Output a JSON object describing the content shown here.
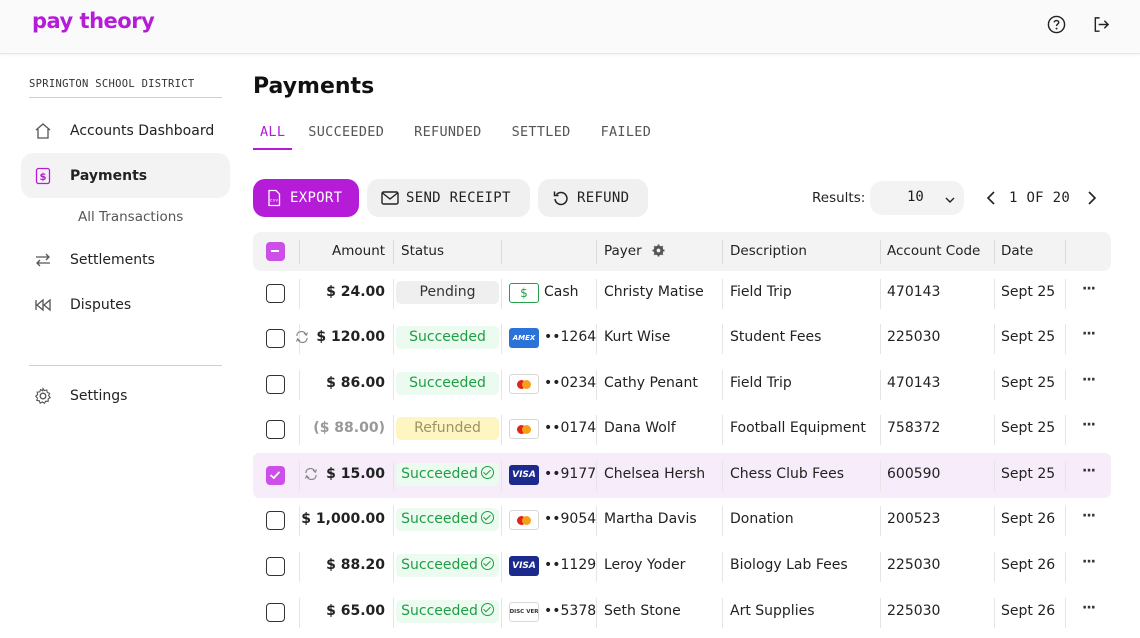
{
  "brand": {
    "logo": "pay theory",
    "accent": "#b51cd8"
  },
  "header": {
    "icons": [
      "help-icon",
      "logout-icon"
    ]
  },
  "sidebar": {
    "district": "SPRINGTON SCHOOL DISTRICT",
    "items": [
      {
        "label": "Accounts Dashboard",
        "icon": "home-icon"
      },
      {
        "label": "Payments",
        "icon": "dollar-doc-icon",
        "active": true
      },
      {
        "label": "Settlements",
        "icon": "swap-arrows-icon"
      },
      {
        "label": "Disputes",
        "icon": "rewind-icon"
      },
      {
        "label": "Settings",
        "icon": "gear-icon"
      }
    ],
    "sub_item": "All Transactions"
  },
  "main": {
    "title": "Payments",
    "tabs": [
      {
        "label": "ALL",
        "active": true
      },
      {
        "label": "SUCCEEDED"
      },
      {
        "label": "REFUNDED"
      },
      {
        "label": "SETTLED"
      },
      {
        "label": "FAILED"
      }
    ],
    "actions": {
      "export": "EXPORT",
      "send_receipt": "SEND RECEIPT",
      "refund": "REFUND"
    },
    "results": {
      "label": "Results:",
      "value": "10"
    },
    "pager": {
      "text": "1 OF 20",
      "current": 1,
      "total": 20
    }
  },
  "table": {
    "columns": [
      "Amount",
      "Status",
      "Payer",
      "Description",
      "Account Code",
      "Date"
    ],
    "rows": [
      {
        "amount": "$ 24.00",
        "recurring": false,
        "status": "Pending",
        "verified": false,
        "method": "cash",
        "method_text": "Cash",
        "payer": "Christy Matise",
        "description": "Field Trip",
        "account_code": "470143",
        "date": "Sept 25",
        "checked": false
      },
      {
        "amount": "$ 120.00",
        "recurring": true,
        "status": "Succeeded",
        "verified": false,
        "method": "amex",
        "method_text": "••1264",
        "payer": "Kurt Wise",
        "description": "Student Fees",
        "account_code": "225030",
        "date": "Sept 25",
        "checked": false
      },
      {
        "amount": "$ 86.00",
        "recurring": false,
        "status": "Succeeded",
        "verified": false,
        "method": "mastercard",
        "method_text": "••0234",
        "payer": "Cathy Penant",
        "description": "Field Trip",
        "account_code": "470143",
        "date": "Sept 25",
        "checked": false
      },
      {
        "amount": "($ 88.00)",
        "recurring": false,
        "status": "Refunded",
        "verified": false,
        "method": "mastercard",
        "method_text": "••0174",
        "payer": "Dana Wolf",
        "description": "Football Equipment",
        "account_code": "758372",
        "date": "Sept 25",
        "checked": false
      },
      {
        "amount": "$ 15.00",
        "recurring": true,
        "status": "Succeeded",
        "verified": true,
        "method": "visa",
        "method_text": "••9177",
        "payer": "Chelsea Hersh",
        "description": "Chess Club Fees",
        "account_code": "600590",
        "date": "Sept 25",
        "checked": true
      },
      {
        "amount": "$ 1,000.00",
        "recurring": false,
        "status": "Succeeded",
        "verified": true,
        "method": "mastercard",
        "method_text": "••9054",
        "payer": "Martha Davis",
        "description": "Donation",
        "account_code": "200523",
        "date": "Sept 26",
        "checked": false
      },
      {
        "amount": "$ 88.20",
        "recurring": false,
        "status": "Succeeded",
        "verified": true,
        "method": "visa",
        "method_text": "••1129",
        "payer": "Leroy Yoder",
        "description": "Biology Lab Fees",
        "account_code": "225030",
        "date": "Sept 26",
        "checked": false
      },
      {
        "amount": "$ 65.00",
        "recurring": false,
        "status": "Succeeded",
        "verified": true,
        "method": "discover",
        "method_text": "••5378",
        "payer": "Seth Stone",
        "description": "Art Supplies",
        "account_code": "225030",
        "date": "Sept 26",
        "checked": false
      }
    ]
  }
}
